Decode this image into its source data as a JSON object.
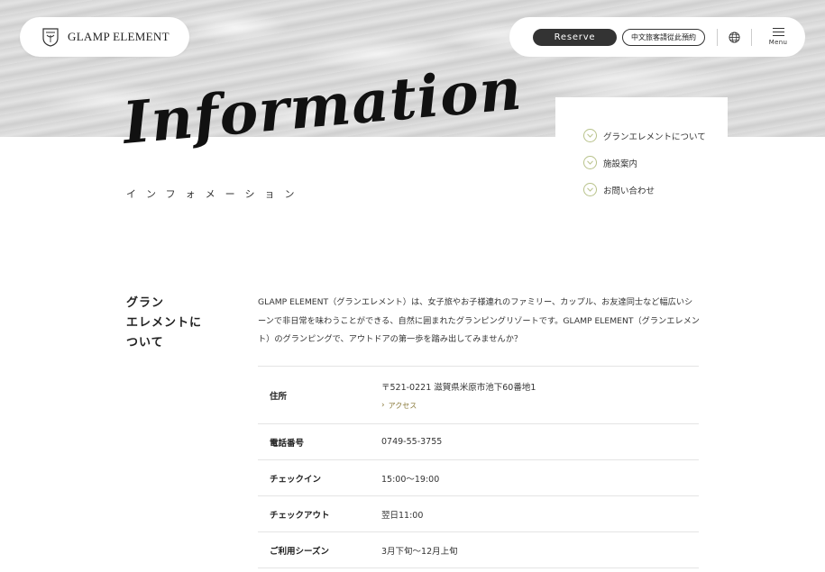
{
  "header": {
    "logo_text": "GLAMP ELEMENT",
    "reserve_label": "Reserve",
    "cn_reserve_label": "中文旅客請從此預約",
    "menu_label": "Menu"
  },
  "hero": {
    "title": "Information",
    "kana": "インフォメーション"
  },
  "side_nav": {
    "items": [
      {
        "label": "グランエレメントについて"
      },
      {
        "label": "施設案内"
      },
      {
        "label": "お問い合わせ"
      }
    ]
  },
  "section": {
    "heading_line1": "グラン",
    "heading_line2": "エレメントに",
    "heading_line3": "ついて",
    "intro": "GLAMP ELEMENT（グランエレメント）は、女子旅やお子様連れのファミリー、カップル、お友達同士など幅広いシーンで非日常を味わうことができる、自然に囲まれたグランピングリゾートです。GLAMP ELEMENT（グランエレメント）のグランピングで、アウトドアの第一歩を踏み出してみませんか？"
  },
  "info_table": {
    "rows": [
      {
        "label": "住所",
        "value": "〒521-0221 滋賀県米原市池下60番地1",
        "link": "アクセス"
      },
      {
        "label": "電話番号",
        "value": "0749-55-3755"
      },
      {
        "label": "チェックイン",
        "value": "15:00〜19:00"
      },
      {
        "label": "チェックアウト",
        "value": "翌日11:00"
      },
      {
        "label": "ご利用シーズン",
        "value": "3月下旬〜12月上旬"
      }
    ]
  },
  "colors": {
    "accent_chevron": "#b8c28a",
    "link": "#8a7a3a",
    "reserve_bg": "#333333"
  }
}
